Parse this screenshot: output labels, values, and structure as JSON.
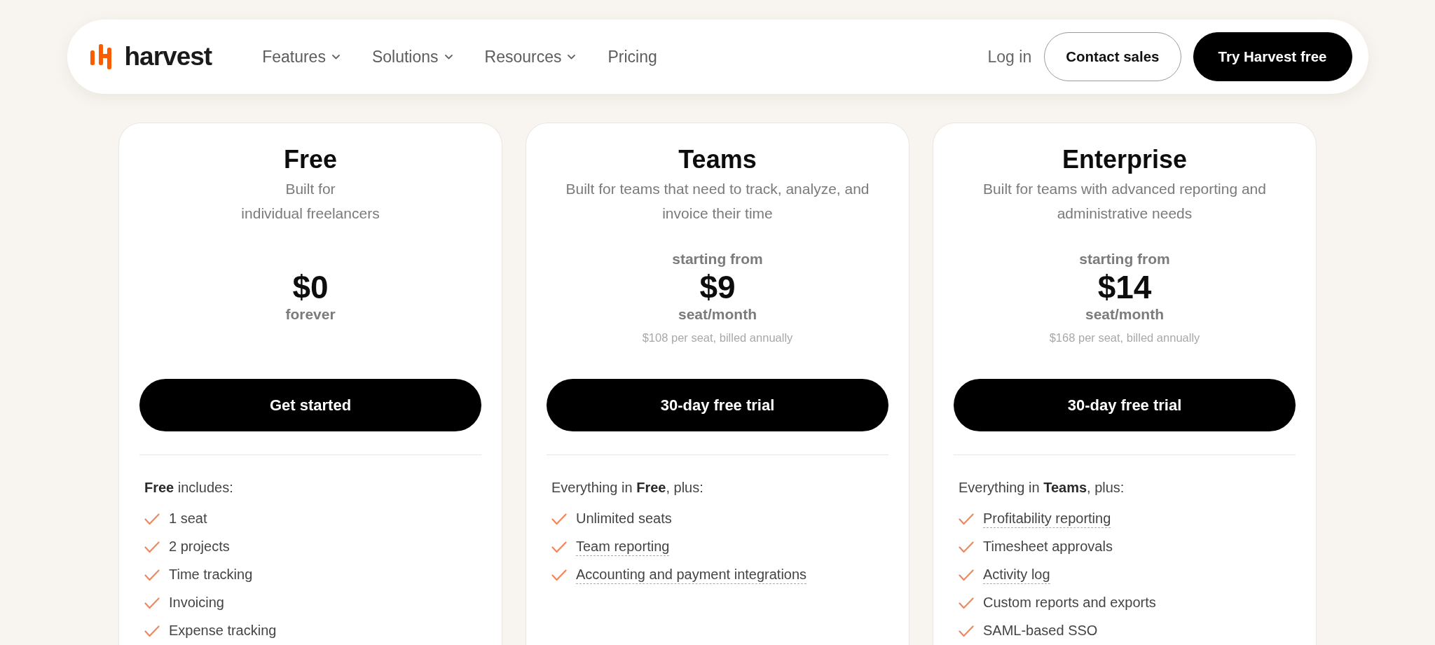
{
  "nav": {
    "wordmark": "harvest",
    "links": [
      {
        "label": "Features",
        "dropdown": true
      },
      {
        "label": "Solutions",
        "dropdown": true
      },
      {
        "label": "Resources",
        "dropdown": true
      },
      {
        "label": "Pricing",
        "dropdown": false
      }
    ],
    "login": "Log in",
    "buttons": [
      {
        "label": "Contact sales",
        "kind": "outline"
      },
      {
        "label": "Try Harvest free",
        "kind": "solid"
      }
    ]
  },
  "plans": [
    {
      "name": "Free",
      "description_lines": [
        "Built for",
        "individual freelancers"
      ],
      "price": "$0",
      "price_unit": "forever",
      "cta": "Get started",
      "features_heading": "**Free** includes:",
      "features": [
        {
          "label": "1 seat",
          "underlined": false
        },
        {
          "label": "2 projects",
          "underlined": false
        },
        {
          "label": "Time tracking",
          "underlined": false
        },
        {
          "label": "Invoicing",
          "underlined": false
        },
        {
          "label": "Expense tracking",
          "underlined": false
        }
      ]
    },
    {
      "name": "Teams",
      "description_lines": [
        "Built for teams that need to track, analyze, and",
        "invoice their time"
      ],
      "price_prefix": "starting from",
      "price": "$9",
      "price_unit": "seat/month",
      "annual_note": "$108 per seat, billed annually",
      "cta": "30-day free trial",
      "features_heading": "Everything in **Free**, plus:",
      "features": [
        {
          "label": "Unlimited seats",
          "underlined": false
        },
        {
          "label": "Team reporting",
          "underlined": true
        },
        {
          "label": "Accounting and payment integrations",
          "underlined": true
        }
      ]
    },
    {
      "name": "Enterprise",
      "description_lines": [
        "Built for teams with advanced reporting and",
        "administrative needs"
      ],
      "price_prefix": "starting from",
      "price": "$14",
      "price_unit": "seat/month",
      "annual_note": "$168 per seat, billed annually",
      "cta": "30-day free trial",
      "features_heading": "Everything in **Teams**, plus:",
      "features": [
        {
          "label": "Profitability reporting",
          "underlined": true
        },
        {
          "label": "Timesheet approvals",
          "underlined": false
        },
        {
          "label": "Activity log",
          "underlined": true
        },
        {
          "label": "Custom reports and exports",
          "underlined": false
        },
        {
          "label": "SAML-based SSO",
          "underlined": false
        }
      ]
    }
  ]
}
